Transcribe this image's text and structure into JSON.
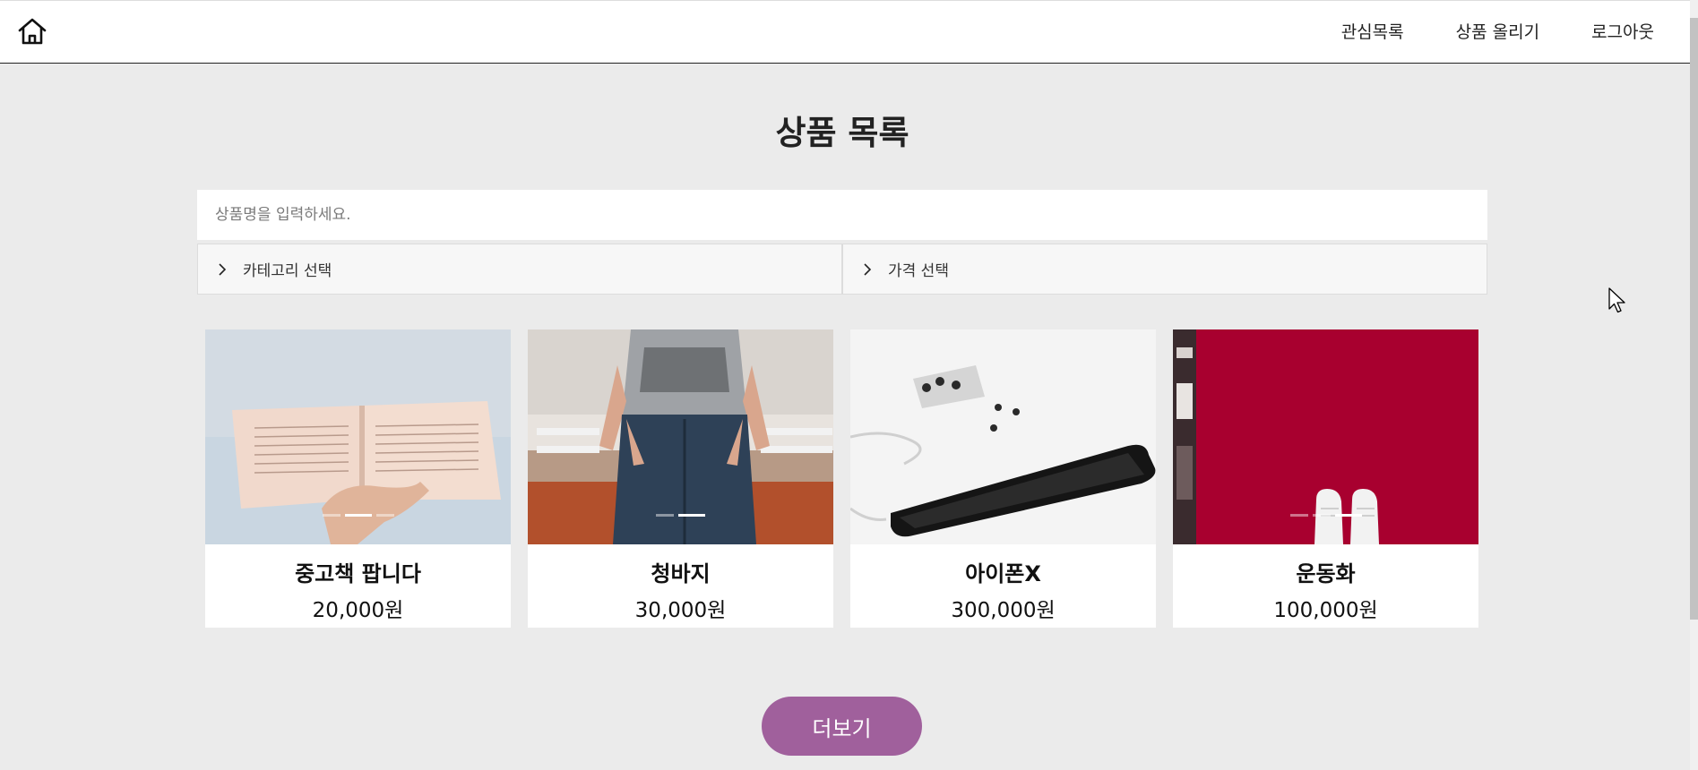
{
  "header": {
    "home_icon": "home-icon",
    "nav": [
      "관심목록",
      "상품 올리기",
      "로그아웃"
    ]
  },
  "page": {
    "title": "상품 목록"
  },
  "search": {
    "placeholder": "상품명을 입력하세요.",
    "value": ""
  },
  "filters": [
    {
      "label": "카테고리 선택",
      "icon": "chevron-right-icon"
    },
    {
      "label": "가격 선택",
      "icon": "chevron-right-icon"
    }
  ],
  "products": [
    {
      "title": "중고책 팝니다",
      "price": "20,000원",
      "image_dots": 3,
      "active_dot": 1
    },
    {
      "title": "청바지",
      "price": "30,000원",
      "image_dots": 2,
      "active_dot": 1
    },
    {
      "title": "아이폰X",
      "price": "300,000원",
      "image_dots": 0,
      "active_dot": 0
    },
    {
      "title": "운동화",
      "price": "100,000원",
      "image_dots": 3,
      "active_dot": 2
    }
  ],
  "more_button": {
    "label": "더보기"
  },
  "colors": {
    "accent": "#a0609c",
    "background": "#ebebeb"
  }
}
